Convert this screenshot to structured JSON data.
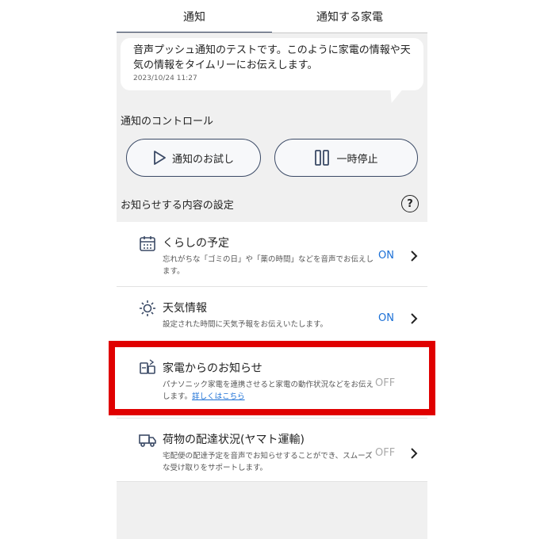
{
  "tabs": [
    {
      "label": "通知",
      "active": true
    },
    {
      "label": "通知する家電",
      "active": false
    }
  ],
  "notification": {
    "text": "音声プッシュ通知のテストです。このように家電の情報や天気の情報をタイムリーにお伝えします。",
    "timestamp": "2023/10/24 11:27"
  },
  "control": {
    "title": "通知のコントロール",
    "try_label": "通知のお試し",
    "pause_label": "一時停止"
  },
  "settings": {
    "title": "お知らせする内容の設定",
    "help_icon": "?",
    "items": [
      {
        "icon": "calendar-icon",
        "title": "くらしの予定",
        "desc": "忘れがちな「ゴミの日」や「薬の時間」などを音声でお伝えします。",
        "status": "ON"
      },
      {
        "icon": "sun-icon",
        "title": "天気情報",
        "desc": "設定された時間に天気予報をお伝えいたします。",
        "status": "ON"
      },
      {
        "icon": "appliance-icon",
        "title": "家電からのお知らせ",
        "desc": "パナソニック家電を連携させると家電の動作状況などをお伝えします。",
        "link": "詳しくはこちら",
        "status": "OFF"
      },
      {
        "icon": "truck-icon",
        "title": "荷物の配達状況(ヤマト運輸)",
        "desc": "宅配便の配達予定を音声でお知らせすることができ、スムーズな受け取りをサポートします。",
        "status": "OFF"
      }
    ]
  },
  "colors": {
    "accent": "#3b4a66",
    "on": "#1a6fd6",
    "off": "#aaaaaa",
    "highlight": "#e00000"
  }
}
